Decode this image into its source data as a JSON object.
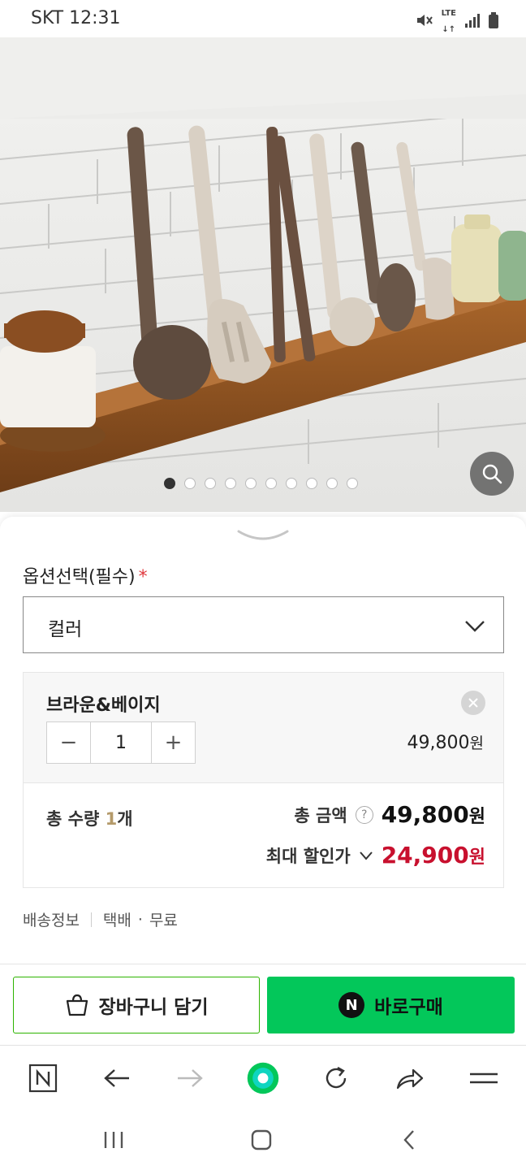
{
  "status_bar": {
    "carrier_time": "SKT 12:31",
    "icons": [
      "mute-icon",
      "lte-icon",
      "signal-icon",
      "battery-icon"
    ],
    "network": "LTE"
  },
  "product": {
    "image_description_icon": "kitchen-utensils-photo",
    "image_count": 10,
    "active_image": 1
  },
  "options": {
    "title": "옵션선택(필수)",
    "required_mark": "*",
    "select_value": "컬러"
  },
  "selected_item": {
    "name": "브라운&베이지",
    "quantity": "1",
    "minus_label": "−",
    "plus_label": "+",
    "price": "49,800",
    "price_unit": "원"
  },
  "totals": {
    "qty_label": "총 수량",
    "qty_value": "1",
    "qty_unit": "개",
    "amount_label": "총 금액",
    "help_label": "?",
    "amount": "49,800",
    "amount_unit": "원",
    "discount_label": "최대 할인가",
    "discount_amount": "24,900",
    "discount_unit": "원"
  },
  "shipping": {
    "label": "배송정보",
    "method": "택배",
    "dot": "·",
    "fee": "무료"
  },
  "actions": {
    "cart_label": "장바구니 담기",
    "buy_badge": "N",
    "buy_label": "바로구매"
  },
  "colors": {
    "naver_green": "#03c75a",
    "discount_red": "#c8102e",
    "cart_border": "#2db400"
  }
}
